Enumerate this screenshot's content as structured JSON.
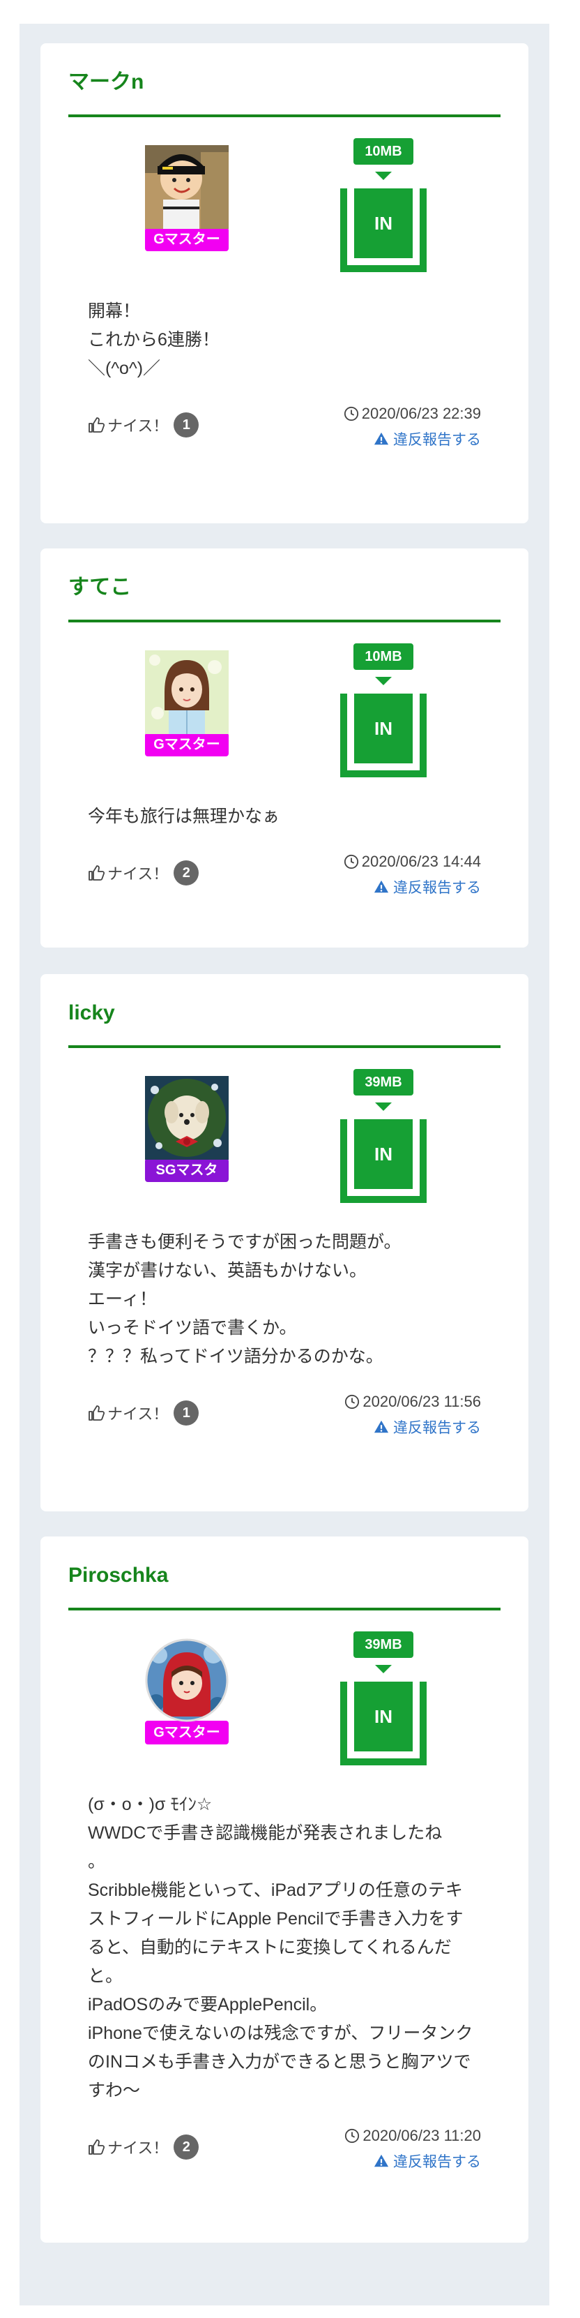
{
  "posts": [
    {
      "name": "マークn",
      "badge": "Gマスター",
      "badge_color": "#f200f2",
      "data_amount": "10MB",
      "direction": "IN",
      "comment": "開幕！\nこれから6連勝！\n＼(^o^)／",
      "nice_label": "ナイス！",
      "nice_count": "1",
      "timestamp": "2020/06/23 22:39",
      "report_label": "違反報告する"
    },
    {
      "name": "すてこ",
      "badge": "Gマスター",
      "badge_color": "#f200f2",
      "data_amount": "10MB",
      "direction": "IN",
      "comment": "今年も旅行は無理かなぁ",
      "nice_label": "ナイス！",
      "nice_count": "2",
      "timestamp": "2020/06/23 14:44",
      "report_label": "違反報告する"
    },
    {
      "name": "licky",
      "badge": "SGマスタ",
      "badge_color": "#8a14d6",
      "data_amount": "39MB",
      "direction": "IN",
      "comment": "手書きも便利そうですが困った問題が。\n漢字が書けない、英語もかけない。\nエーィ！\nいっそドイツ語で書くか。\n？？？私ってドイツ語分かるのかな。",
      "nice_label": "ナイス！",
      "nice_count": "1",
      "timestamp": "2020/06/23 11:56",
      "report_label": "違反報告する"
    },
    {
      "name": "Piroschka",
      "badge": "Gマスター",
      "badge_color": "#f200f2",
      "data_amount": "39MB",
      "direction": "IN",
      "comment": "(σ・o・)σ ﾓｲﾝ☆\nWWDCで手書き認識機能が発表されましたね\n。\nScribble機能といって、iPadアプリの任意のテキストフィールドにApple Pencilで手書き入力をすると、自動的にテキストに変換してくれるんだと。\niPadOSのみで要ApplePencil。\niPhoneで使えないのは残念ですが、フリータンクのINコメも手書き入力ができると思うと胸アツですわ〜",
      "nice_label": "ナイス！",
      "nice_count": "2",
      "timestamp": "2020/06/23 11:20",
      "report_label": "違反報告する"
    }
  ],
  "colors": {
    "accent_green": "#16851c",
    "data_green": "#16a034",
    "link_blue": "#2f74c8",
    "feed_bg": "#e8edf2"
  },
  "icons": {
    "nice": "thumbs-up-icon",
    "time": "clock-icon",
    "report": "warning-icon"
  }
}
